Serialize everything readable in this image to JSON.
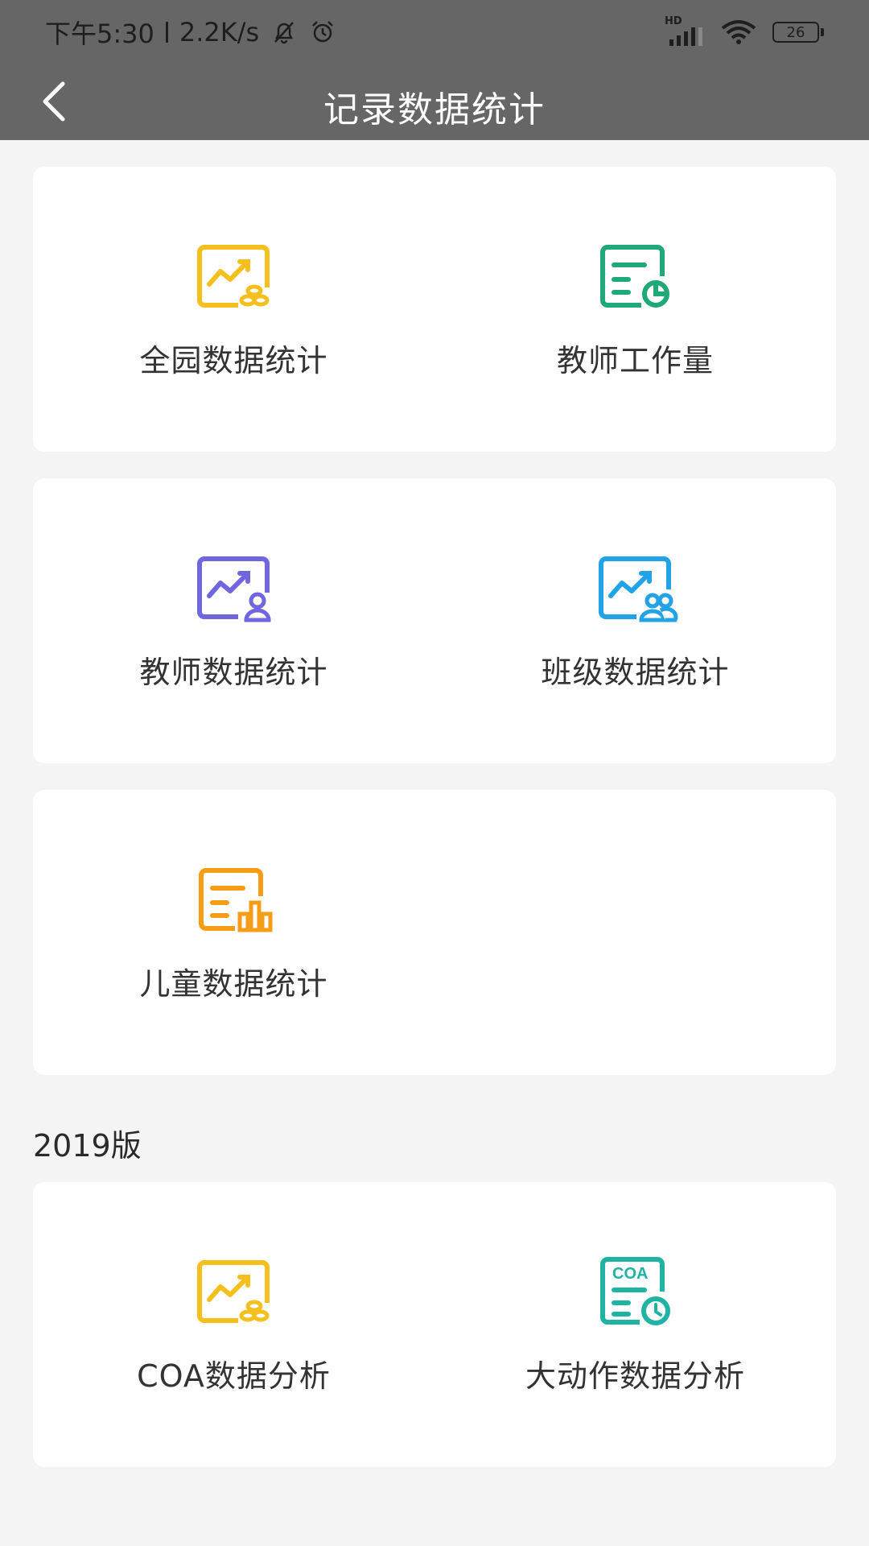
{
  "status_bar": {
    "time": "下午5:30",
    "speed": "2.2K/s",
    "network_badge": "HD",
    "battery": "26"
  },
  "header": {
    "title": "记录数据统计"
  },
  "cards": [
    {
      "tiles": [
        {
          "label": "全园数据统计",
          "icon": "chart-trend-coins-icon",
          "color": "#f5bf1d"
        },
        {
          "label": "教师工作量",
          "icon": "document-pie-icon",
          "color": "#1fa878"
        }
      ]
    },
    {
      "tiles": [
        {
          "label": "教师数据统计",
          "icon": "chart-trend-user-icon",
          "color": "#6f66e0"
        },
        {
          "label": "班级数据统计",
          "icon": "chart-trend-group-icon",
          "color": "#22a3e8"
        }
      ]
    },
    {
      "tiles": [
        {
          "label": "儿童数据统计",
          "icon": "document-bar-chart-icon",
          "color": "#f59d16"
        }
      ]
    }
  ],
  "section": {
    "label": "2019版"
  },
  "cards_2019": [
    {
      "tiles": [
        {
          "label": "COA数据分析",
          "icon": "chart-trend-coins-icon",
          "color": "#f5bf1d"
        },
        {
          "label": "大动作数据分析",
          "icon": "coa-document-clock-icon",
          "color": "#1fb3a3",
          "icon_text": "COA"
        }
      ]
    }
  ]
}
